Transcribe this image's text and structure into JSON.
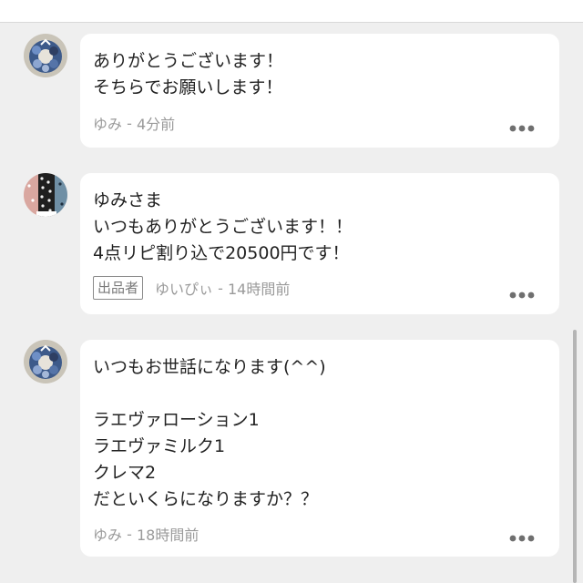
{
  "comments": [
    {
      "text": "ありがとうございます！\nそちらでお願いします！",
      "author": "ゆみ",
      "time": "4分前",
      "seller": false
    },
    {
      "text": "ゆみさま\nいつもありがとうございます！！\n4点リピ割り込で20500円です！",
      "author": "ゆいぴぃ",
      "time": "14時間前",
      "seller": true,
      "badge": "出品者"
    },
    {
      "text": "いつもお世話になります(^^)\n\nラエヴァローション1\nラエヴァミルク1\nクレマ2\nだといくらになりますか？？",
      "author": "ゆみ",
      "time": "18時間前",
      "seller": false
    }
  ],
  "meta_separator": " - ",
  "icons": {
    "avatar_buyer": "wreath-avatar-icon",
    "avatar_seller": "polka-dot-pouches-avatar-icon",
    "more": "more-options-icon"
  }
}
